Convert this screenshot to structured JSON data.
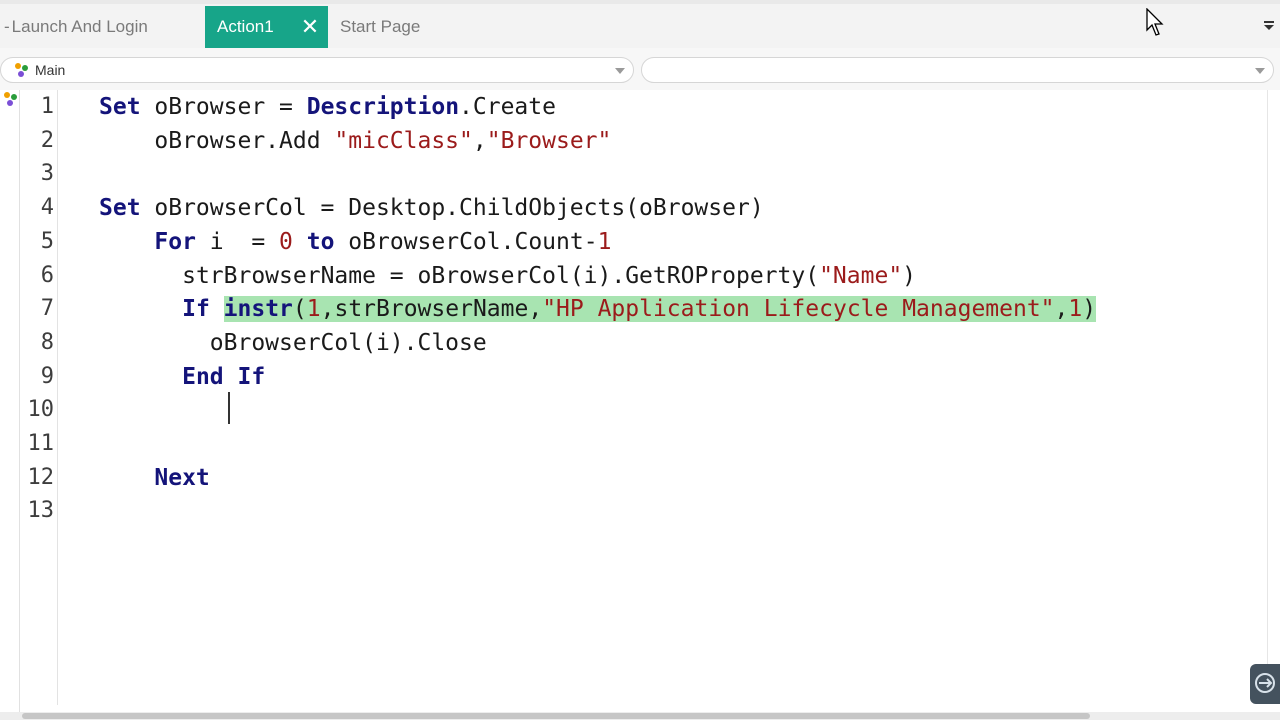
{
  "tabs": [
    {
      "label": "Launch And Login",
      "active": false
    },
    {
      "label": "Action1",
      "active": true,
      "close_icon": "close-icon"
    },
    {
      "label": "Start Page",
      "active": false
    }
  ],
  "colors": {
    "active_tab": "#17a589",
    "highlight": "#a8e4b1",
    "keyword": "#14147a",
    "string": "#9b1b1b"
  },
  "dropdowns": {
    "scope": {
      "value": "Main",
      "icon": "action-tree-icon"
    },
    "member": {
      "value": ""
    }
  },
  "editor": {
    "cursor_line": 10,
    "lines": [
      {
        "num": "1",
        "parts": [
          {
            "t": "Set",
            "c": "kw"
          },
          {
            "t": " oBrowser = ",
            "c": ""
          },
          {
            "t": "Description",
            "c": "kw"
          },
          {
            "t": ".Create",
            "c": ""
          }
        ]
      },
      {
        "num": "2",
        "indent": "    ",
        "parts": [
          {
            "t": "oBrowser.Add ",
            "c": ""
          },
          {
            "t": "\"micClass\"",
            "c": "str"
          },
          {
            "t": ",",
            "c": ""
          },
          {
            "t": "\"Browser\"",
            "c": "str"
          }
        ]
      },
      {
        "num": "3",
        "parts": []
      },
      {
        "num": "4",
        "parts": [
          {
            "t": "Set",
            "c": "kw"
          },
          {
            "t": " oBrowserCol = Desktop.ChildObjects(oBrowser)",
            "c": ""
          }
        ]
      },
      {
        "num": "5",
        "indent": "    ",
        "parts": [
          {
            "t": "For",
            "c": "kw"
          },
          {
            "t": " i  = ",
            "c": ""
          },
          {
            "t": "0",
            "c": "num"
          },
          {
            "t": " ",
            "c": ""
          },
          {
            "t": "to",
            "c": "kw"
          },
          {
            "t": " oBrowserCol.Count-",
            "c": ""
          },
          {
            "t": "1",
            "c": "num"
          }
        ]
      },
      {
        "num": "6",
        "indent": "      ",
        "parts": [
          {
            "t": "strBrowserName = oBrowserCol(i).GetROProperty(",
            "c": ""
          },
          {
            "t": "\"Name\"",
            "c": "str"
          },
          {
            "t": ")",
            "c": ""
          }
        ]
      },
      {
        "num": "7",
        "indent": "      ",
        "parts": [
          {
            "t": "If",
            "c": "kw"
          },
          {
            "t": " ",
            "c": ""
          },
          {
            "t": "instr",
            "c": "kw hl"
          },
          {
            "t": "(",
            "c": "hl"
          },
          {
            "t": "1",
            "c": "num hl"
          },
          {
            "t": ",strBrowserName,",
            "c": "hl"
          },
          {
            "t": "\"HP Application Lifecycle Management\"",
            "c": "str hl"
          },
          {
            "t": ",",
            "c": "hl"
          },
          {
            "t": "1",
            "c": "num hl"
          },
          {
            "t": ")",
            "c": "hl"
          }
        ]
      },
      {
        "num": "8",
        "indent": "        ",
        "parts": [
          {
            "t": "oBrowserCol(i).Close",
            "c": ""
          }
        ]
      },
      {
        "num": "9",
        "indent": "      ",
        "parts": [
          {
            "t": "End If",
            "c": "kw"
          }
        ]
      },
      {
        "num": "10",
        "parts": []
      },
      {
        "num": "11",
        "parts": []
      },
      {
        "num": "12",
        "indent": "    ",
        "parts": [
          {
            "t": "Next",
            "c": "kw"
          }
        ]
      },
      {
        "num": "13",
        "parts": []
      }
    ]
  },
  "widget": {
    "icon": "remote-session-icon"
  },
  "pointer": {
    "icon": "mouse-pointer-icon"
  }
}
